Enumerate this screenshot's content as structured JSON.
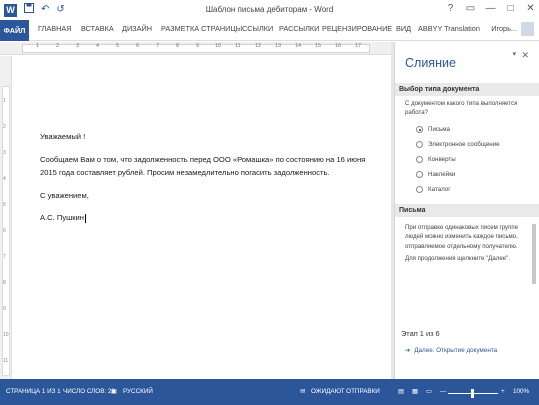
{
  "window": {
    "title": "Шаблон письма дебиторам - Word",
    "controls": [
      "?",
      "▭",
      "—",
      "□",
      "✕"
    ]
  },
  "qat": {
    "logo": "W",
    "save_icon": "save-icon",
    "undo": "↶",
    "redo": "↺"
  },
  "ribbon": {
    "file_tab": "ФАЙЛ",
    "tabs": [
      "ГЛАВНАЯ",
      "ВСТАВКА",
      "ДИЗАЙН",
      "РАЗМЕТКА СТРАНИЦЫ",
      "ССЫЛКИ",
      "РАССЫЛКИ",
      "РЕЦЕНЗИРОВАНИЕ",
      "ВИД",
      "ABBYY Translation"
    ],
    "user": "Игорь..."
  },
  "ruler": {
    "marks": [
      "1",
      "2",
      "3",
      "4",
      "5",
      "6",
      "7",
      "8",
      "9",
      "10",
      "11",
      "12",
      "13",
      "14",
      "15",
      "16",
      "17"
    ]
  },
  "document": {
    "greeting": "Уважаемый !",
    "para_line1": "Сообщаем Вам о том, что задолженность перед ООО «Ромашка» по состоянию на 16 июня",
    "para_line2": "2015 года составляет рублей. Просим незамедлительно погасить задолженность.",
    "closing": "С уважением,",
    "signature": "А.С. Пушкин"
  },
  "pane": {
    "title": "Слияние",
    "section1_header": "Выбор типа документа",
    "question": "С документом какого типа выполняется работа?",
    "options": [
      "Письма",
      "Электронное сообщение",
      "Конверты",
      "Наклейки",
      "Каталог"
    ],
    "selected_option": "Письма",
    "section2_header": "Письма",
    "letters_desc": "При отправке одинаковых писем группе людей можно изменить каждое письмо, отправляемое отдельному получателю.",
    "continue_hint": "Для продолжения щелкните \"Далее\".",
    "step": "Этап 1 из 6",
    "next_link": "Далее. Открытие документа"
  },
  "status": {
    "page": "СТРАНИЦА 1 ИЗ 1",
    "words": "ЧИСЛО СЛОВ: 28",
    "lang": "РУССКИЙ",
    "sending": "ОЖИДАЮТ ОТПРАВКИ",
    "zoom_minus": "—",
    "zoom_plus": "+",
    "zoom": "100%"
  },
  "colors": {
    "accent": "#2b579a"
  }
}
